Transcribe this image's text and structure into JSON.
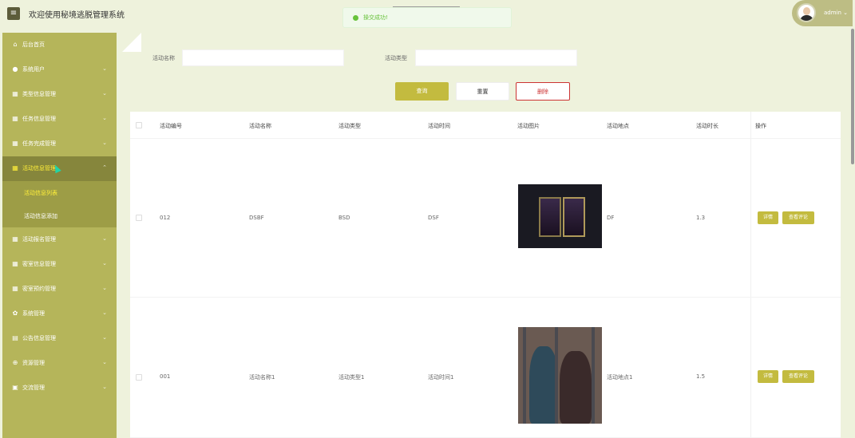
{
  "header": {
    "menu_icon": "menu-icon",
    "title": "欢迎使用秘境逃脱管理系统",
    "user": "admin",
    "user_chevron": "⌄"
  },
  "toast": {
    "icon": "check-circle-icon",
    "text": "操交成功!"
  },
  "sidebar": {
    "items": [
      {
        "label": "后台首页",
        "icon": "home-icon",
        "glyph": "⌂",
        "chev": ""
      },
      {
        "label": "系统用户",
        "icon": "user-icon",
        "glyph": "●",
        "chev": "⌄"
      },
      {
        "label": "类型信息管理",
        "icon": "grid-icon",
        "glyph": "▦",
        "chev": "⌄"
      },
      {
        "label": "任务信息管理",
        "icon": "grid-icon",
        "glyph": "▦",
        "chev": "⌄"
      },
      {
        "label": "任务完成管理",
        "icon": "grid-icon",
        "glyph": "▦",
        "chev": "⌄"
      },
      {
        "label": "活动信息管理",
        "icon": "grid-icon",
        "glyph": "▦",
        "chev": "⌃"
      },
      {
        "label": "活动报名管理",
        "icon": "grid-icon",
        "glyph": "▦",
        "chev": "⌄"
      },
      {
        "label": "密室信息管理",
        "icon": "grid-icon",
        "glyph": "▦",
        "chev": "⌄"
      },
      {
        "label": "密室预约管理",
        "icon": "grid-icon",
        "glyph": "▦",
        "chev": "⌄"
      },
      {
        "label": "系统管理",
        "icon": "gear-icon",
        "glyph": "✿",
        "chev": "⌄"
      },
      {
        "label": "公告信息管理",
        "icon": "document-icon",
        "glyph": "▤",
        "chev": "⌄"
      },
      {
        "label": "资源管理",
        "icon": "plus-circle-icon",
        "glyph": "⊕",
        "chev": "⌄"
      },
      {
        "label": "交流管理",
        "icon": "chat-icon",
        "glyph": "▣",
        "chev": "⌄"
      }
    ],
    "sub_items": [
      {
        "label": "活动信息列表",
        "active": true
      },
      {
        "label": "活动信息添加",
        "active": false
      }
    ]
  },
  "filters": {
    "name_label": "活动名称",
    "name_value": "",
    "type_label": "活动类型",
    "type_value": ""
  },
  "buttons": {
    "query": "查询",
    "reset": "重置",
    "delete": "删除"
  },
  "table": {
    "columns": [
      "活动编号",
      "活动名称",
      "活动类型",
      "活动时间",
      "活动图片",
      "活动地点",
      "活动时长",
      "操作"
    ],
    "rows": [
      {
        "id": "012",
        "name": "DSBF",
        "type": "BSD",
        "time": "DSF",
        "image": "game-cards-image",
        "place": "DF",
        "duration": "1.3",
        "detail": "详情",
        "comments": "查看评论"
      },
      {
        "id": "001",
        "name": "活动名称1",
        "type": "活动类型1",
        "time": "活动时间1",
        "image": "two-people-behind-bars-image",
        "place": "活动地点1",
        "duration": "1.5",
        "detail": "详情",
        "comments": "查看评论"
      }
    ]
  },
  "colors": {
    "sidebar": "#b5b55a",
    "sidebar_active": "#86863c",
    "accent": "#c3bb3f",
    "danger": "#cc3333",
    "background": "#eef2dc"
  }
}
